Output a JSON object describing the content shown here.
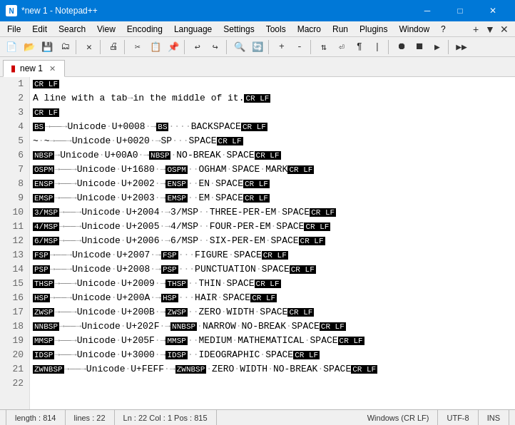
{
  "titlebar": {
    "title": "*new 1 - Notepad++",
    "icon_label": "N",
    "min_label": "─",
    "max_label": "□",
    "close_label": "✕"
  },
  "menubar": {
    "items": [
      "File",
      "Edit",
      "Search",
      "View",
      "Encoding",
      "Language",
      "Settings",
      "Tools",
      "Macro",
      "Run",
      "Plugins",
      "Window",
      "?"
    ],
    "plus_label": "+",
    "arrow_label": "▼",
    "close_label": "✕"
  },
  "tabs": [
    {
      "label": "new 1",
      "active": true
    }
  ],
  "statusbar": {
    "length": "length : 814",
    "lines": "lines : 22",
    "position": "Ln : 22   Col : 1   Pos : 815",
    "line_endings": "Windows (CR LF)",
    "encoding": "UTF-8",
    "ins": "INS"
  },
  "lines": [
    {
      "num": "1",
      "content": "CRLF"
    },
    {
      "num": "2",
      "content": "A line with a tab→in the middle of it.CRLF"
    },
    {
      "num": "3",
      "content": "CRLF"
    },
    {
      "num": "4",
      "content": "BS→——→Unicode·U+0008·→BS····BACKSPACECRLF"
    },
    {
      "num": "5",
      "content": "~·~→——→Unicode·U+0020·→SP···SPACECRLF"
    },
    {
      "num": "6",
      "content": "NBSP→Unicode·U+00A0·→NBSP·NO-BREAK·SPACECRLF"
    },
    {
      "num": "7",
      "content": "OSPM→——→Unicode·U+1680·→OSPM··OGHAM·SPACE·MARKCRLF"
    },
    {
      "num": "8",
      "content": "ENSP→——→Unicode·U+2002·→ENSP··EN·SPACECRLF"
    },
    {
      "num": "9",
      "content": "EMSP→——→Unicode·U+2003·→EMSP··EM·SPACECRLF"
    },
    {
      "num": "10",
      "content": "3/MSP→——→Unicode·U+2004·→3/MSP··THREE-PER-EM·SPACECRLF"
    },
    {
      "num": "11",
      "content": "4/MSP→——→Unicode·U+2005·→4/MSP··FOUR-PER-EM·SPACECRLF"
    },
    {
      "num": "12",
      "content": "6/MSP→——→Unicode·U+2006·→6/MSP··SIX-PER-EM·SPACECRLF"
    },
    {
      "num": "13",
      "content": "FSP→——→Unicode·U+2007·→FSP···FIGURE·SPACECRLF"
    },
    {
      "num": "14",
      "content": "PSP→——→Unicode·U+2008·→PSP···PUNCTUATION·SPACECRLF"
    },
    {
      "num": "15",
      "content": "THSP→——→Unicode·U+2009·→THSP··THIN·SPACECRLF"
    },
    {
      "num": "16",
      "content": "HSP→——→Unicode·U+200A·→HSP···HAIR·SPACECRLF"
    },
    {
      "num": "17",
      "content": "ZWSP→——→Unicode·U+200B·→ZWSP··ZERO·WIDTH·SPACECRLF"
    },
    {
      "num": "18",
      "content": "NNBSP→——→Unicode·U+202F·→NNBSP·NARROW·NO-BREAK·SPACECRLF"
    },
    {
      "num": "19",
      "content": "MMSP→——→Unicode·U+205F·→MMSP··MEDIUM·MATHEMATICAL·SPACECRLF"
    },
    {
      "num": "20",
      "content": "IDSP→——→Unicode·U+3000·→IDSP··IDEOGRAPHIC·SPACECRLF"
    },
    {
      "num": "21",
      "content": "ZWNBSP→——→Unicode·U+FEFF·→ZWNBSP·ZERO·WIDTH·NO-BREAK·SPACECRLF"
    },
    {
      "num": "22",
      "content": ""
    }
  ]
}
